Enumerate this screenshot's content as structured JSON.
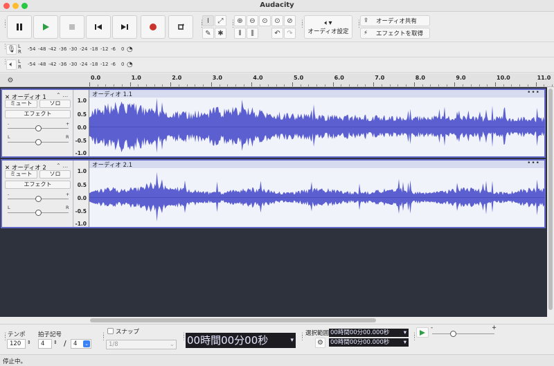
{
  "window": {
    "title": "Audacity"
  },
  "toolbar": {
    "share_audio_label": "オーディオ共有",
    "get_effects_label": "エフェクトを取得",
    "audio_setup_label": "オーディオ設定",
    "audio_setup_arrow": "▾"
  },
  "meters": {
    "lr_top": "L",
    "lr_bottom": "R",
    "scale": [
      "-54",
      "-48",
      "-42",
      "-36",
      "-30",
      "-24",
      "-18",
      "-12",
      "-6",
      "0"
    ]
  },
  "ruler": {
    "labels": [
      "0.0",
      "1.0",
      "2.0",
      "3.0",
      "4.0",
      "5.0",
      "6.0",
      "7.0",
      "8.0",
      "9.0",
      "10.0",
      "11.0"
    ]
  },
  "tracks": [
    {
      "name": "オーディオ 1",
      "clip_name": "オーディオ 1.1",
      "close": "✕",
      "menu": "…",
      "mute_label": "ミュート",
      "solo_label": "ソロ",
      "effects_label": "エフェクト",
      "gain_minus": "-",
      "gain_plus": "+",
      "pan_left": "L",
      "pan_right": "R",
      "scale": [
        "1.0",
        "0.5",
        "0.0",
        "-0.5",
        "-1.0"
      ]
    },
    {
      "name": "オーディオ 2",
      "clip_name": "オーディオ 2.1",
      "close": "✕",
      "menu": "…",
      "mute_label": "ミュート",
      "solo_label": "ソロ",
      "effects_label": "エフェクト",
      "gain_minus": "-",
      "gain_plus": "+",
      "pan_left": "L",
      "pan_right": "R",
      "scale": [
        "1.0",
        "0.5",
        "0.0",
        "-0.5",
        "-1.0"
      ]
    }
  ],
  "bottom": {
    "tempo_label": "テンポ",
    "tempo_value": "120",
    "timesig_label": "拍子記号",
    "timesig_num": "4",
    "timesig_slash": "/",
    "timesig_den": "4",
    "snap_label": "スナップ",
    "snap_value": "1/8",
    "time_display": "00時間00分00秒",
    "selection_label": "選択範囲",
    "selection_start": "00時間00分00.000秒",
    "selection_end": "00時間00分00.000秒",
    "play_speed_minus": "-",
    "play_speed_plus": "+"
  },
  "status": {
    "text": "停止中。"
  },
  "colors": {
    "waveform": "#5b5fd0",
    "accent": "#6168c7",
    "record": "#c8332b",
    "play": "#2f9e44"
  }
}
